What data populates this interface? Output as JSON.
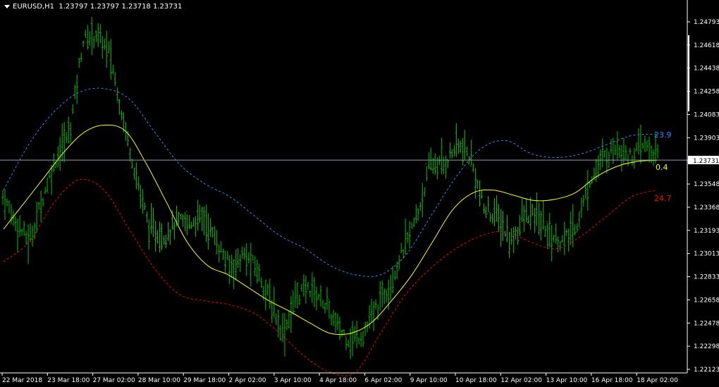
{
  "header": {
    "symbol": "EURUSD,H1",
    "ohlc": "1.23797 1.23797 1.23718 1.23731"
  },
  "colors": {
    "background": "#000000",
    "bars": "#00c000",
    "ma": "#ffff00",
    "upper": "#1e90ff",
    "lower": "#ff0000",
    "axis": "#ffffff",
    "current": "#8aa0b4"
  },
  "price_axis": {
    "ticks": [
      "1.24793",
      "1.24618",
      "1.24438",
      "1.24258",
      "1.24083",
      "1.23903",
      "1.23728",
      "1.23548",
      "1.23368",
      "1.23193",
      "1.23013",
      "1.22833",
      "1.22658",
      "1.22478",
      "1.22298",
      "1.22123"
    ],
    "current_price": "1.23731"
  },
  "time_axis": {
    "ticks": [
      "22 Mar 2018",
      "23 Mar 18:00",
      "27 Mar 02:00",
      "28 Mar 10:00",
      "29 Mar 18:00",
      "2 Apr 02:00",
      "3 Apr 10:00",
      "4 Apr 18:00",
      "6 Apr 02:00",
      "9 Apr 10:00",
      "10 Apr 18:00",
      "12 Apr 02:00",
      "13 Apr 10:00",
      "16 Apr 18:00",
      "18 Apr 02:00"
    ]
  },
  "indicator_labels": {
    "upper": "23.9",
    "middle": "0.4",
    "lower": "24.7"
  },
  "chart_data": {
    "type": "line",
    "series": [
      {
        "name": "price",
        "values": [
          1.2345,
          1.2325,
          1.231,
          1.2345,
          1.2375,
          1.2395,
          1.2465,
          1.247,
          1.2455,
          1.2405,
          1.236,
          1.232,
          1.2315,
          1.2325,
          1.2325,
          1.233,
          1.231,
          1.229,
          1.23,
          1.229,
          1.2265,
          1.224,
          1.227,
          1.2275,
          1.2265,
          1.2245,
          1.2235,
          1.224,
          1.226,
          1.228,
          1.2305,
          1.233,
          1.237,
          1.237,
          1.2385,
          1.2375,
          1.2335,
          1.233,
          1.231,
          1.233,
          1.233,
          1.2315,
          1.231,
          1.2325,
          1.236,
          1.2375,
          1.2385,
          1.2375,
          1.2385,
          1.2375
        ]
      },
      {
        "name": "ma",
        "values": [
          1.232,
          1.234,
          1.236,
          1.238,
          1.2395,
          1.24,
          1.2395,
          1.237,
          1.234,
          1.231,
          1.2292,
          1.2285,
          1.2275,
          1.2265,
          1.2257,
          1.2248,
          1.224,
          1.224,
          1.2248,
          1.2265,
          1.2285,
          1.231,
          1.2335,
          1.2348,
          1.235,
          1.2346,
          1.2342,
          1.2343,
          1.2348,
          1.236,
          1.2368,
          1.2372,
          1.2373
        ]
      },
      {
        "name": "upper",
        "values": [
          1.235,
          1.2385,
          1.241,
          1.2425,
          1.2428,
          1.242,
          1.2395,
          1.237,
          1.2355,
          1.2345,
          1.233,
          1.2315,
          1.2305,
          1.2292,
          1.2285,
          1.2285,
          1.23,
          1.233,
          1.236,
          1.2382,
          1.2388,
          1.2378,
          1.2375,
          1.2378,
          1.2385,
          1.2392,
          1.2393
        ]
      },
      {
        "name": "lower",
        "values": [
          1.2295,
          1.231,
          1.234,
          1.2358,
          1.235,
          1.232,
          1.229,
          1.227,
          1.2265,
          1.2262,
          1.2255,
          1.224,
          1.2222,
          1.221,
          1.221,
          1.224,
          1.227,
          1.229,
          1.2305,
          1.2315,
          1.2318,
          1.231,
          1.2305,
          1.2315,
          1.233,
          1.2345,
          1.235
        ]
      }
    ],
    "ylim": [
      1.22123,
      1.24793
    ]
  }
}
